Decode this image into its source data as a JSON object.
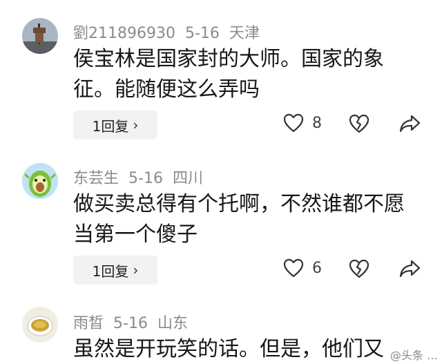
{
  "comments": [
    {
      "username": "劉211896930",
      "date": "5-16",
      "location": "天津",
      "text": "侯宝林是国家封的大师。国家的象征。能随便这么弄吗",
      "reply_label": "1回复",
      "like_count": "8"
    },
    {
      "username": "东芸生",
      "date": "5-16",
      "location": "四川",
      "text": "做买卖总得有个托啊，不然谁都不愿当第一个傻子",
      "reply_label": "1回复",
      "like_count": "6"
    },
    {
      "username": "雨晳",
      "date": "5-16",
      "location": "山东",
      "text": "虽然是开玩笑的话。但是，他们又"
    }
  ],
  "icons": {
    "chevron": "›",
    "like": "heart-outline-icon",
    "dislike": "broken-heart-icon",
    "share": "share-arrow-icon"
  },
  "watermark": "@头条 …"
}
